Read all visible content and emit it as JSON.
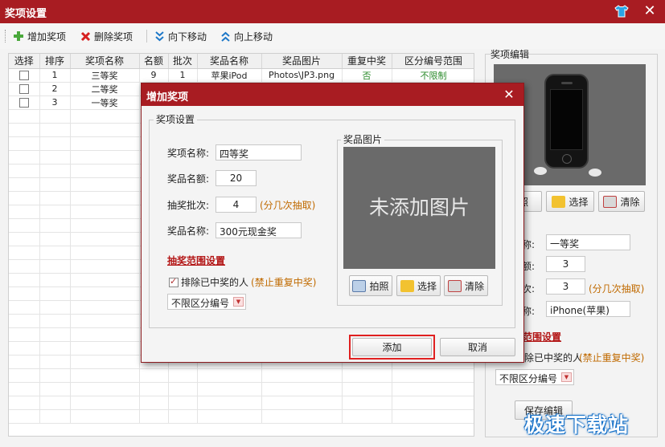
{
  "window": {
    "title": "奖项设置",
    "skin_icon": "tshirt-icon",
    "close_glyph": "✕"
  },
  "toolbar": {
    "add": "增加奖项",
    "delete": "删除奖项",
    "move_down": "向下移动",
    "move_up": "向上移动",
    "colors": {
      "add_icon": "#4aa83c",
      "delete_icon": "#d62020",
      "move_icon": "#1e78c8"
    }
  },
  "table": {
    "columns": [
      "选择",
      "排序",
      "奖项名称",
      "名额",
      "批次",
      "奖品名称",
      "奖品图片",
      "重复中奖",
      "区分编号范围"
    ],
    "rows": [
      [
        "",
        "1",
        "三等奖",
        "9",
        "1",
        "苹果iPod",
        "Photos\\JP3.png",
        "否",
        "不限制"
      ],
      [
        "",
        "2",
        "二等奖",
        "",
        "",
        "",
        "",
        "",
        ""
      ],
      [
        "",
        "3",
        "一等奖",
        "",
        "",
        "",
        "",
        "",
        ""
      ]
    ]
  },
  "edit_panel": {
    "title": "奖项编辑",
    "take_photo": "拍照",
    "choose": "选择",
    "clear": "清除",
    "name_label": "称:",
    "name_value": "一等奖",
    "quota_label": "额:",
    "quota_value": "3",
    "batch_label": "次:",
    "batch_value": "3",
    "batch_hint": "(分几次抽取)",
    "prize_label": "称:",
    "prize_value": "iPhone(苹果)",
    "range_title": "范围设置",
    "exclude_label": "除已中奖的人",
    "exclude_hint": "(禁止重复中奖)",
    "range_select": "不限区分编号",
    "save": "保存编辑"
  },
  "dialog": {
    "title": "增加奖项",
    "close_glyph": "✕",
    "group_title": "奖项设置",
    "name_label": "奖项名称:",
    "name_value": "四等奖",
    "quota_label": "奖品名额:",
    "quota_value": "20",
    "batch_label": "抽奖批次:",
    "batch_value": "4",
    "batch_hint": "(分几次抽取)",
    "prize_label": "奖品名称:",
    "prize_value": "300元现金奖",
    "range_title": "抽奖范围设置",
    "exclude_label": "排除已中奖的人",
    "exclude_hint": "(禁止重复中奖)",
    "range_select": "不限区分编号",
    "image_group": "奖品图片",
    "no_image": "未添加图片",
    "take_photo": "拍照",
    "choose": "选择",
    "clear": "清除",
    "add": "添加",
    "cancel": "取消"
  },
  "watermark": "极速下载站"
}
